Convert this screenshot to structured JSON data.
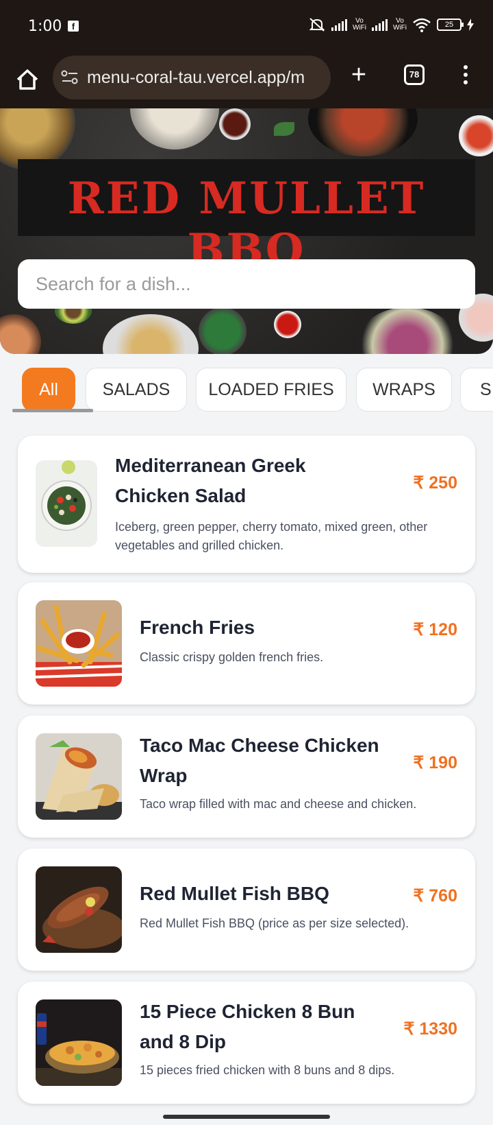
{
  "status_bar": {
    "time": "1:00",
    "battery": "25",
    "icons": [
      "facebook-icon",
      "mute-icon",
      "signal-icon",
      "vowifi-icon",
      "wifi-icon",
      "battery-icon",
      "charging-icon"
    ],
    "vowifi_top": "Vo",
    "vowifi_bottom": "WiFi"
  },
  "browser": {
    "url": "menu-coral-tau.vercel.app/m",
    "tab_count": "78",
    "icons": [
      "home-icon",
      "site-settings-icon",
      "new-tab-icon",
      "tabs-icon",
      "more-icon"
    ]
  },
  "hero": {
    "logo_text": "RED MULLET BBQ",
    "search_placeholder": "Search for a dish..."
  },
  "categories": [
    {
      "label": "All",
      "active": true
    },
    {
      "label": "SALADS",
      "active": false
    },
    {
      "label": "LOADED FRIES",
      "active": false
    },
    {
      "label": "WRAPS",
      "active": false
    },
    {
      "label": "S",
      "active": false
    }
  ],
  "menu_items": [
    {
      "name": "Mediterranean Greek Chicken Salad",
      "description": "Iceberg, green pepper, cherry tomato, mixed green, other vegetables and grilled chicken.",
      "price": "₹ 250"
    },
    {
      "name": "French Fries",
      "description": "Classic crispy golden french fries.",
      "price": "₹ 120"
    },
    {
      "name": "Taco Mac Cheese Chicken Wrap",
      "description": "Taco wrap filled with mac and cheese and chicken.",
      "price": "₹ 190"
    },
    {
      "name": "Red Mullet Fish BBQ",
      "description": "Red Mullet Fish BBQ (price as per size selected).",
      "price": "₹ 760"
    },
    {
      "name": "15 Piece Chicken 8 Bun and 8 Dip",
      "description": "15 pieces fried chicken with 8 buns and 8 dips.",
      "price": "₹ 1330"
    }
  ],
  "colors": {
    "accent": "#f47a1f",
    "logo_red": "#d72a22",
    "topbar": "#1f1713"
  }
}
